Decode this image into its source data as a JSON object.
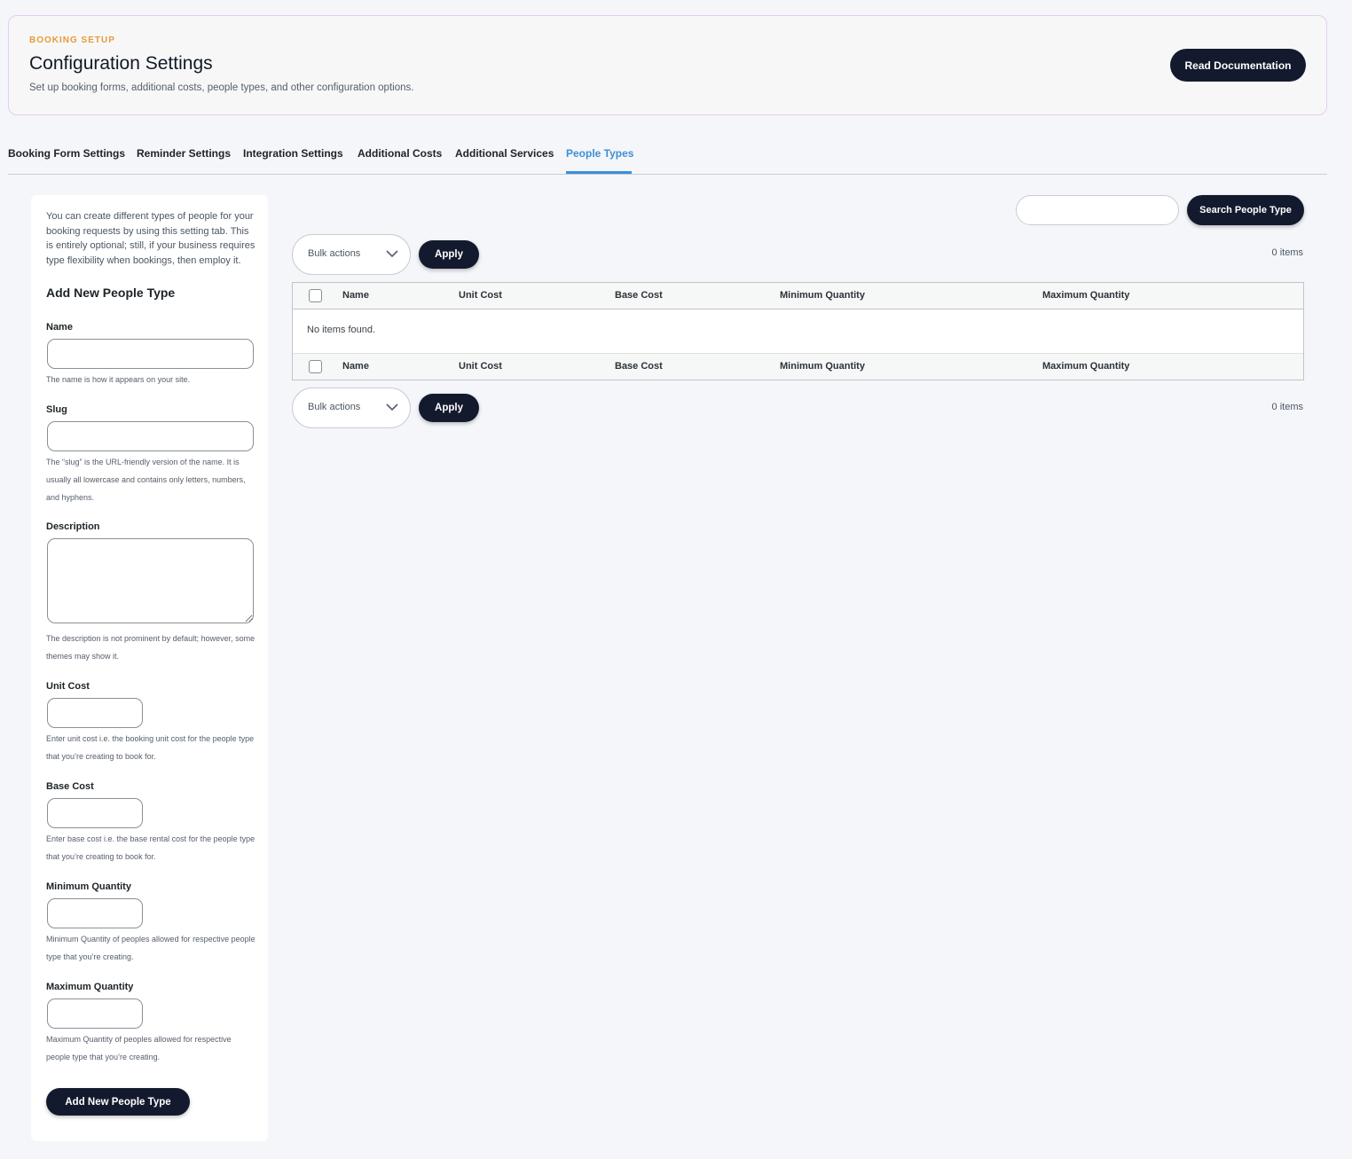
{
  "header": {
    "eyebrow": "BOOKING SETUP",
    "title": "Configuration Settings",
    "subtitle": "Set up booking forms, additional costs, people types, and other configuration options.",
    "doc_button": "Read Documentation"
  },
  "tabs": [
    {
      "label": "Booking Form Settings"
    },
    {
      "label": "Reminder Settings"
    },
    {
      "label": "Integration Settings"
    },
    {
      "label": "Additional Costs"
    },
    {
      "label": "Additional Services"
    },
    {
      "label": "People Types",
      "active": true
    }
  ],
  "form": {
    "intro": "You can create different types of people for your booking requests by using this setting tab. This is entirely optional; still, if your business requires type flexibility when bookings, then employ it.",
    "title": "Add New People Type",
    "name": {
      "label": "Name",
      "value": "",
      "help": "The name is how it appears on your site."
    },
    "slug": {
      "label": "Slug",
      "value": "",
      "help": "The “slug” is the URL-friendly version of the name. It is usually all lowercase and contains only letters, numbers, and hyphens."
    },
    "description": {
      "label": "Description",
      "value": "",
      "help": "The description is not prominent by default; however, some themes may show it."
    },
    "unit_cost": {
      "label": "Unit Cost",
      "value": "",
      "help": "Enter unit cost i.e. the booking unit cost for the people type that you’re creating to book for."
    },
    "base_cost": {
      "label": "Base Cost",
      "value": "",
      "help": "Enter base cost i.e. the base rental cost for the people type that you’re creating to book for."
    },
    "min_qty": {
      "label": "Minimum Quantity",
      "value": "",
      "help": "Minimum Quantity of peoples allowed for respective people type that you’re creating."
    },
    "max_qty": {
      "label": "Maximum Quantity",
      "value": "",
      "help": "Maximum Quantity of peoples allowed for respective people type that you’re creating."
    },
    "submit": "Add New People Type"
  },
  "list": {
    "search_value": "",
    "search_button": "Search People Type",
    "bulk_actions": "Bulk actions",
    "apply": "Apply",
    "count": "0 items",
    "columns": [
      "Name",
      "Unit Cost",
      "Base Cost",
      "Minimum Quantity",
      "Maximum Quantity"
    ],
    "empty": "No items found."
  },
  "icons": {
    "dropdown": "chevron-down-icon"
  },
  "colors": {
    "primary_dark": "#141a2e",
    "accent_blue": "#3d8fd6",
    "eyebrow_orange": "#e79b3a"
  }
}
